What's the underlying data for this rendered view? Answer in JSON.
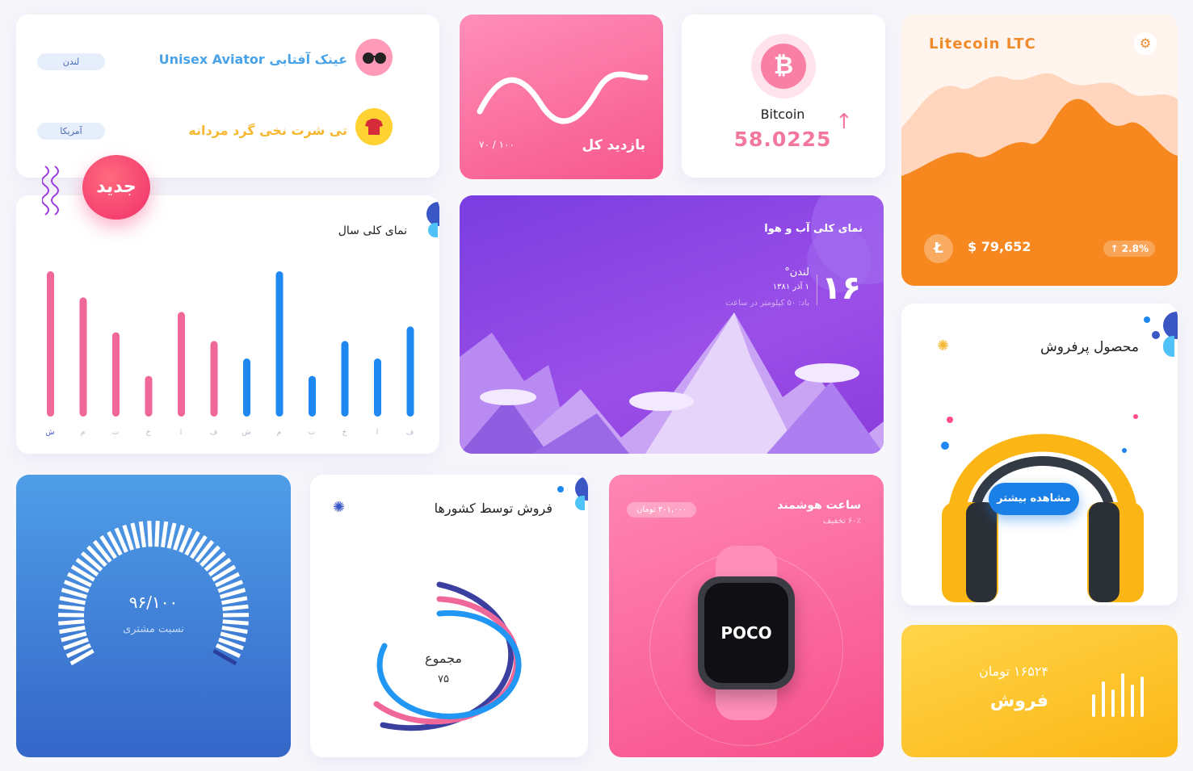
{
  "products": {
    "items": [
      {
        "name": "عینک آفتابی Unisex Aviator",
        "location": "لندن"
      },
      {
        "name": "تی شرت نخی گرد مردانه",
        "location": "آمریکا"
      }
    ]
  },
  "new_badge": "جدید",
  "visits": {
    "title": "بازدید کل",
    "ratio": "۱۰۰ / ۷۰"
  },
  "bitcoin": {
    "label": "Bitcoin",
    "value": "58.0225",
    "icon": "bitcoin-icon"
  },
  "litecoin": {
    "title": "Litecoin LTC",
    "price": "$ 79,652",
    "change": "2.8%",
    "accent": "#f7871f"
  },
  "year_overview": {
    "title": "نمای کلی سال",
    "chart_data": {
      "type": "bar",
      "categories": [
        "ف",
        "ا",
        "خ",
        "ت",
        "م",
        "ش",
        "ف",
        "ا",
        "خ",
        "ت",
        "م",
        "ش"
      ],
      "values": [
        62,
        40,
        52,
        28,
        100,
        40,
        52,
        72,
        28,
        58,
        82,
        100
      ],
      "ylim": [
        0,
        100
      ],
      "colors": [
        "#1e88f0",
        "#1e88f0",
        "#1e88f0",
        "#1e88f0",
        "#1e88f0",
        "#1e88f0",
        "#f0679a",
        "#f0679a",
        "#f0679a",
        "#f0679a",
        "#f0679a",
        "#f0679a"
      ]
    }
  },
  "weather": {
    "title": "نمای کلی آب و هوا",
    "temperature": "۱۶",
    "city": "لندن°",
    "date": "۱ آذر ۱۳۸۱",
    "wind": "باد: ۵۰ کیلومتر در ساعت"
  },
  "bestseller": {
    "title": "محصول پرفروش",
    "button": "مشاهده بیشتر"
  },
  "gauge": {
    "value": "۹۶/۱۰۰",
    "label": "نسبت مشتری",
    "fraction": 0.96
  },
  "country_sales": {
    "title": "فروش توسط کشورها",
    "total_label": "مجموع",
    "total_value": "۷۵"
  },
  "watch": {
    "title": "ساعت هوشمند",
    "discount": "۶۰٪ تخفیف",
    "price": "۳۰۱,۰۰۰ تومان",
    "brand": "POCO"
  },
  "sales": {
    "amount": "۱۶۵۲۴ تومان",
    "label": "فروش"
  }
}
